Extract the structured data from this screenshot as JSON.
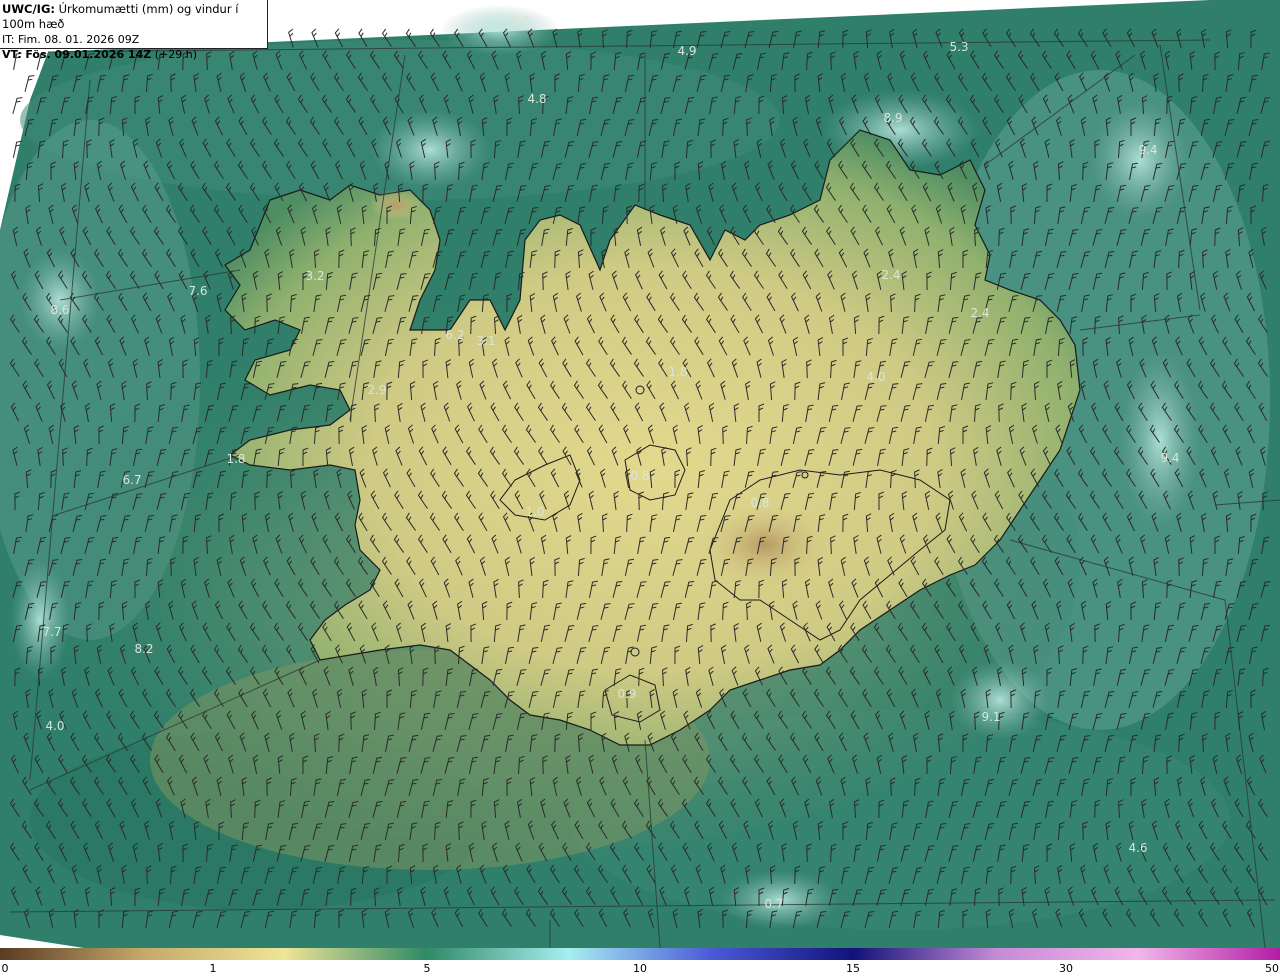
{
  "title": {
    "model": "UWC/IG:",
    "parameter": "Úrkomumætti (mm) og vindur í 100m hæð",
    "it_prefix": "IT:",
    "it_time": "Fim. 08. 01. 2026 09Z",
    "vt_prefix": "VT:",
    "vt_time": "Fös. 09.01.2026 14Z",
    "vt_offset": "(+29 h)"
  },
  "colors": {
    "water_dark": "#1f6e5a",
    "water_mid": "#3f8a77",
    "water_light": "#7fb4a8",
    "land_green": "#4f8e63",
    "land_yellow": "#d9d48a",
    "land_tan": "#b39560",
    "coastline": "#1a1a1a",
    "grid": "#2a3a36",
    "barb": "#2b2b2b",
    "label": "#d9e6da"
  },
  "value_labels": [
    {
      "id": "l1",
      "text": "8.0"
    },
    {
      "id": "l2",
      "text": "4.9"
    },
    {
      "id": "l3",
      "text": "5.3"
    },
    {
      "id": "l4",
      "text": "4.8"
    },
    {
      "id": "l5",
      "text": "8.9"
    },
    {
      "id": "l6",
      "text": "9.4"
    },
    {
      "id": "l7",
      "text": "3.2"
    },
    {
      "id": "l8",
      "text": "7.6"
    },
    {
      "id": "l9",
      "text": "8.6"
    },
    {
      "id": "l10",
      "text": "2.4"
    },
    {
      "id": "l11",
      "text": "2.4"
    },
    {
      "id": "l12",
      "text": "6.2"
    },
    {
      "id": "l13",
      "text": "3.1"
    },
    {
      "id": "l14",
      "text": "4.0"
    },
    {
      "id": "l15",
      "text": "2.9"
    },
    {
      "id": "l16",
      "text": "1.8"
    },
    {
      "id": "l17",
      "text": "6.7"
    },
    {
      "id": "l18",
      "text": "1.0"
    },
    {
      "id": "l19",
      "text": "1.8"
    },
    {
      "id": "l20",
      "text": "0.8"
    },
    {
      "id": "l21",
      "text": "0.8"
    },
    {
      "id": "l22",
      "text": "9.4"
    },
    {
      "id": "l23",
      "text": "7.7"
    },
    {
      "id": "l24",
      "text": "8.2"
    },
    {
      "id": "l25",
      "text": "0.9"
    },
    {
      "id": "l26",
      "text": "9.1"
    },
    {
      "id": "l27",
      "text": "4.0"
    },
    {
      "id": "l28",
      "text": "4.6"
    },
    {
      "id": "l29",
      "text": "0.7"
    }
  ],
  "colorbar": {
    "ticks": [
      "0",
      "1",
      "5",
      "10",
      "15",
      "30",
      "50"
    ],
    "stops": [
      "#5a3b24",
      "#c4a86a",
      "#efe596",
      "#2f8a66",
      "#a6eef0",
      "#4a5ad8",
      "#12127a",
      "#c48ad6",
      "#f2b6ea",
      "#b21ca6"
    ]
  }
}
